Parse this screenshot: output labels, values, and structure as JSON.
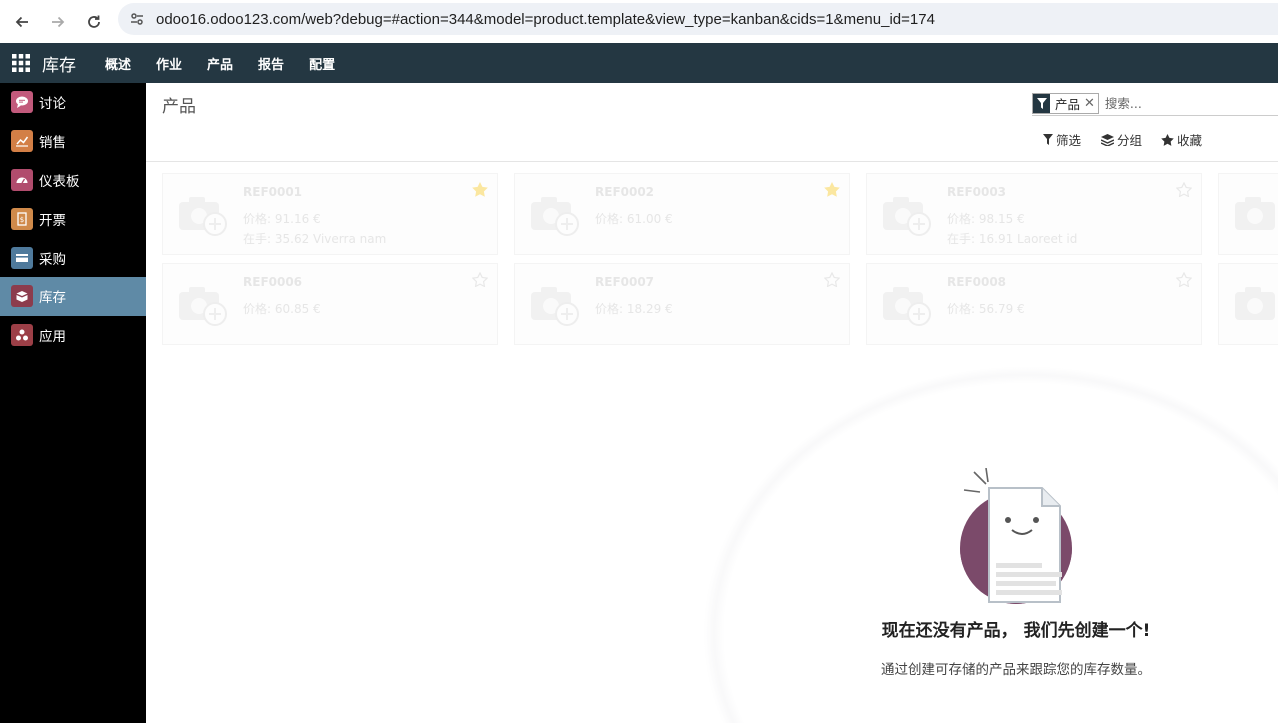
{
  "browser": {
    "url": "odoo16.odoo123.com/web?debug=#action=344&model=product.template&view_type=kanban&cids=1&menu_id=174"
  },
  "topnav": {
    "app_name": "库存",
    "menu": [
      "概述",
      "作业",
      "产品",
      "报告",
      "配置"
    ]
  },
  "sidebar": {
    "items": [
      {
        "label": "讨论",
        "icon": "discuss-icon",
        "color": "#c25a7c"
      },
      {
        "label": "销售",
        "icon": "sales-icon",
        "color": "#d37f46"
      },
      {
        "label": "仪表板",
        "icon": "dashboard-icon",
        "color": "#b14c6d"
      },
      {
        "label": "开票",
        "icon": "invoicing-icon",
        "color": "#d08a4a"
      },
      {
        "label": "采购",
        "icon": "purchase-icon",
        "color": "#4f7a9c"
      },
      {
        "label": "库存",
        "icon": "inventory-icon",
        "color": "#8c3c4d",
        "active": true
      },
      {
        "label": "应用",
        "icon": "apps-icon",
        "color": "#9c3f47"
      }
    ]
  },
  "control": {
    "title": "产品",
    "search": {
      "facet_label": "产品",
      "placeholder": "搜索..."
    },
    "filter_label": "筛选",
    "group_label": "分组",
    "favorite_label": "收藏"
  },
  "kanban": {
    "cards": [
      {
        "ref": "REF0001",
        "price": "价格: 91.16 €",
        "onhand": "在手:   35.62 Viverra nam",
        "starred": true
      },
      {
        "ref": "REF0002",
        "price": "价格: 61.00 €",
        "onhand": "",
        "starred": true
      },
      {
        "ref": "REF0003",
        "price": "价格: 98.15 €",
        "onhand": "在手:   16.91 Laoreet id",
        "starred": false
      },
      {
        "ref": "REF0006",
        "price": "价格: 60.85 €",
        "onhand": "",
        "starred": false
      },
      {
        "ref": "REF0007",
        "price": "价格: 18.29 €",
        "onhand": "",
        "starred": false
      },
      {
        "ref": "REF0008",
        "price": "价格: 56.79 €",
        "onhand": "",
        "starred": false
      }
    ]
  },
  "empty_state": {
    "title": "现在还没有产品， 我们先创建一个!",
    "subtitle": "通过创建可存储的产品来跟踪您的库存数量。"
  },
  "colors": {
    "navbar": "#243742",
    "sidebar": "#000000",
    "active_item": "#5f8aa6",
    "star": "#f3cc00"
  }
}
